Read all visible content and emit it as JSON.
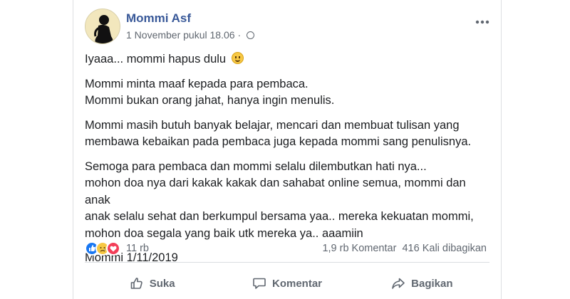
{
  "post": {
    "author": "Mommi Asf",
    "timestamp": "1 November pukul 18.06",
    "separator": "·",
    "privacy_icon": "globe-icon",
    "more_icon": "more-horizontal-icon",
    "paragraphs": [
      [
        "Iyaaa... mommi hapus dulu"
      ],
      [
        "Mommi minta maaf kepada para pembaca.",
        "Mommi bukan orang jahat, hanya ingin menulis."
      ],
      [
        "Mommi masih butuh banyak belajar, mencari dan membuat tulisan yang",
        "membawa kebaikan pada pembaca juga kepada mommi sang penulisnya."
      ],
      [
        "Semoga para pembaca dan mommi selalu dilembutkan hati nya...",
        "mohon doa nya dari kakak kakak dan sahabat online semua, mommi dan anak",
        "anak selalu sehat dan berkumpul bersama yaa.. mereka kekuatan mommi,",
        "mohon doa segala yang baik utk mereka ya.. aaamiin"
      ],
      [
        "Mommi 1/11/2019"
      ]
    ],
    "emoji": "smile-emoji"
  },
  "stats": {
    "reactions": [
      "like",
      "sad",
      "love"
    ],
    "reaction_count": "11 rb",
    "comments": "1,9 rb Komentar",
    "shares": "416 Kali dibagikan"
  },
  "actions": {
    "like_label": "Suka",
    "comment_label": "Komentar",
    "share_label": "Bagikan"
  },
  "colors": {
    "author": "#385898",
    "muted": "#606770",
    "like": "#1877f2",
    "love": "#f33e58",
    "sad": "#f7c844"
  }
}
